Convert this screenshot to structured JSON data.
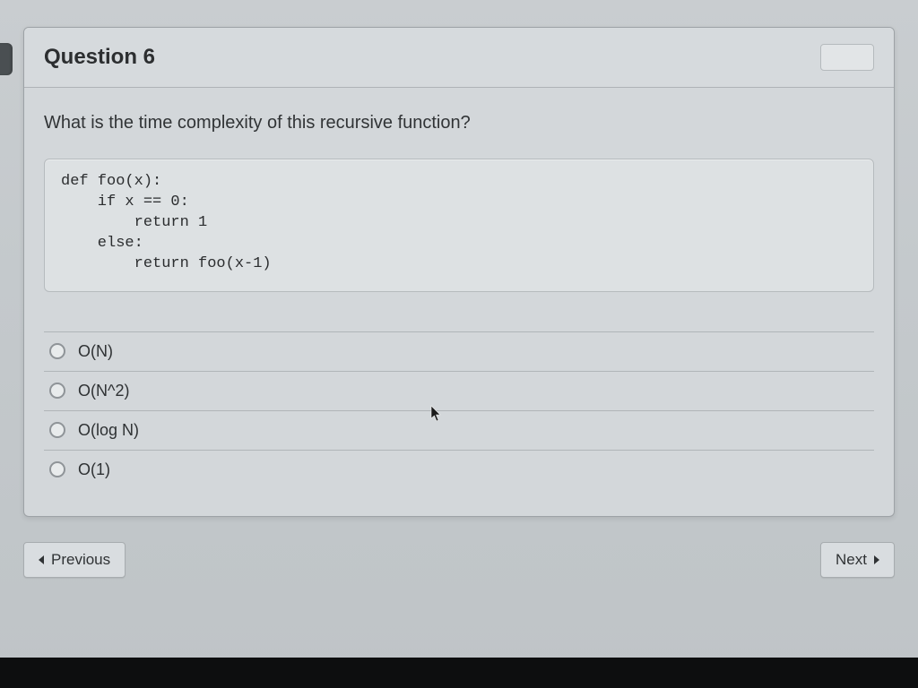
{
  "header": {
    "title": "Question 6"
  },
  "question": {
    "prompt": "What is the time complexity of this recursive function?",
    "code": "def foo(x):\n    if x == 0:\n        return 1\n    else:\n        return foo(x-1)"
  },
  "options": [
    {
      "label": "O(N)"
    },
    {
      "label": "O(N^2)"
    },
    {
      "label": "O(log N)"
    },
    {
      "label": "O(1)"
    }
  ],
  "nav": {
    "previous": "Previous",
    "next": "Next"
  }
}
